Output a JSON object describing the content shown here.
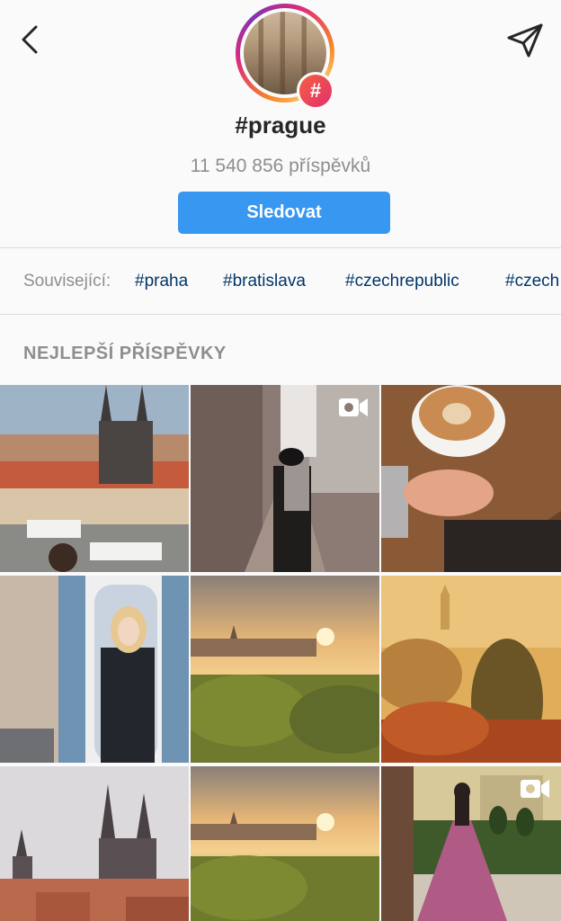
{
  "header": {
    "hashtag": "#prague",
    "post_count": "11 540 856 příspěvků",
    "follow_label": "Sledovat",
    "badge_symbol": "#"
  },
  "related": {
    "label": "Související:",
    "tags": [
      "#praha",
      "#bratislava",
      "#czechrepublic",
      "#czech"
    ]
  },
  "top_posts": {
    "title": "NEJLEPŠÍ PŘÍSPĚVKY",
    "posts": [
      {
        "subject": "prague-old-town-square-aerial",
        "is_video": false
      },
      {
        "subject": "woman-in-hat-forest-path",
        "is_video": true
      },
      {
        "subject": "latte-coffee-cup",
        "is_video": false
      },
      {
        "subject": "woman-sunglasses-striped-doorway",
        "is_video": false
      },
      {
        "subject": "prague-castle-sunrise",
        "is_video": false
      },
      {
        "subject": "petrin-tower-misty-trees",
        "is_video": false
      },
      {
        "subject": "tyn-church-skyline",
        "is_video": false
      },
      {
        "subject": "prague-castle-sunrise-2",
        "is_video": false
      },
      {
        "subject": "woman-pink-gown-garden",
        "is_video": true
      }
    ]
  },
  "icons": {
    "back": "back-arrow-icon",
    "send": "paper-plane-icon",
    "video": "video-camera-icon"
  },
  "colors": {
    "follow_button": "#3897f0",
    "related_tag": "#003569",
    "secondary_text": "#8e8e8e"
  }
}
